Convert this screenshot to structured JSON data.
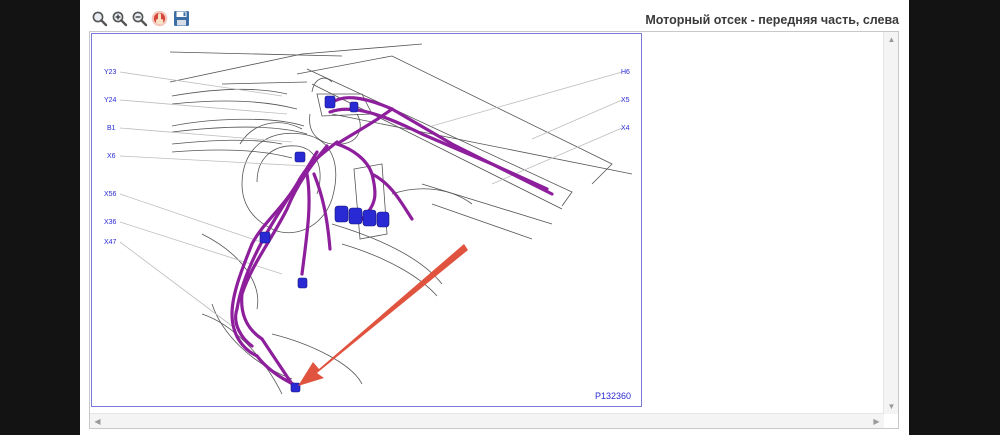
{
  "toolbar": {
    "tools": [
      {
        "name": "zoom-fit-icon",
        "color": "#5a5a5a"
      },
      {
        "name": "zoom-in-icon",
        "color": "#5a5a5a"
      },
      {
        "name": "zoom-out-icon",
        "color": "#5a5a5a"
      },
      {
        "name": "pan-hand-icon",
        "color": "#c0392b"
      },
      {
        "name": "save-icon",
        "color": "#3a6ea5"
      }
    ]
  },
  "page_title": "Моторный отсек - передняя часть, слева",
  "callouts": {
    "left": [
      "Y23",
      "Y24",
      "B1",
      "X6",
      "X56",
      "X36",
      "X47"
    ],
    "right": [
      "H6",
      "X5",
      "X4"
    ]
  },
  "figure_id": "P132360",
  "colors": {
    "harness": "#8e1f9c",
    "connector": "#2a2ad4",
    "arrow": "#e0533f",
    "leader": "#bdbdbd"
  }
}
